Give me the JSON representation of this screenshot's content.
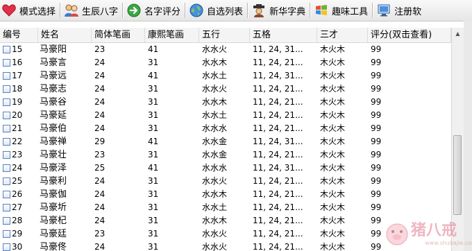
{
  "toolbar": {
    "buttons": [
      {
        "label": "模式选择",
        "icon": "heart-icon"
      },
      {
        "label": "生辰八字",
        "icon": "people-icon"
      },
      {
        "label": "名字评分",
        "icon": "arrow-right-icon"
      },
      {
        "label": "自选列表",
        "icon": "globe-icon"
      },
      {
        "label": "新华字典",
        "icon": "scholar-icon"
      },
      {
        "label": "趣味工具",
        "icon": "windows-logo-icon"
      },
      {
        "label": "注册软",
        "icon": "monitor-icon"
      }
    ]
  },
  "table": {
    "columns": [
      "编号",
      "姓名",
      "简体笔画",
      "康熙笔画",
      "五行",
      "五格",
      "三才",
      "评分(双击查看)"
    ],
    "rows": [
      [
        "15",
        "马豪阳",
        "23",
        "41",
        "水水火",
        "11, 24, 31...",
        "木火木",
        "99"
      ],
      [
        "16",
        "马豪言",
        "24",
        "31",
        "水水木",
        "11, 24, 21...",
        "木火木",
        "99"
      ],
      [
        "17",
        "马豪远",
        "24",
        "41",
        "水水土",
        "11, 24, 31...",
        "木火木",
        "99"
      ],
      [
        "18",
        "马豪志",
        "24",
        "31",
        "水水火",
        "11, 24, 21...",
        "木火木",
        "99"
      ],
      [
        "19",
        "马豪谷",
        "24",
        "31",
        "水水木",
        "11, 24, 21...",
        "木火木",
        "99"
      ],
      [
        "20",
        "马豪延",
        "24",
        "31",
        "水水土",
        "11, 24, 21...",
        "木火木",
        "99"
      ],
      [
        "21",
        "马豪伯",
        "24",
        "31",
        "水水水",
        "11, 24, 21...",
        "木火木",
        "99"
      ],
      [
        "22",
        "马豪禅",
        "29",
        "41",
        "水水金",
        "11, 24, 31...",
        "木火木",
        "99"
      ],
      [
        "23",
        "马豪壮",
        "23",
        "31",
        "水水金",
        "11, 24, 21...",
        "木火木",
        "99"
      ],
      [
        "24",
        "马豪泽",
        "25",
        "41",
        "水水水",
        "11, 24, 31...",
        "木火木",
        "99"
      ],
      [
        "25",
        "马豪利",
        "24",
        "31",
        "水水火",
        "11, 24, 21...",
        "木火木",
        "99"
      ],
      [
        "26",
        "马豪伽",
        "24",
        "31",
        "水水木",
        "11, 24, 21...",
        "木火木",
        "99"
      ],
      [
        "27",
        "马豪圻",
        "24",
        "31",
        "水水土",
        "11, 24, 21...",
        "木火木",
        "99"
      ],
      [
        "28",
        "马豪杞",
        "24",
        "31",
        "水水木",
        "11, 24, 21...",
        "木火木",
        "99"
      ],
      [
        "29",
        "马豪廷",
        "23",
        "31",
        "水水火",
        "11, 24, 21...",
        "木火木",
        "99"
      ],
      [
        "30",
        "马豪佟",
        "24",
        "31",
        "水水火",
        "11, 24, 21...",
        "木火木",
        "99"
      ]
    ]
  },
  "watermark": {
    "text": "猪八戒",
    "url": "www.shubajie.com"
  }
}
